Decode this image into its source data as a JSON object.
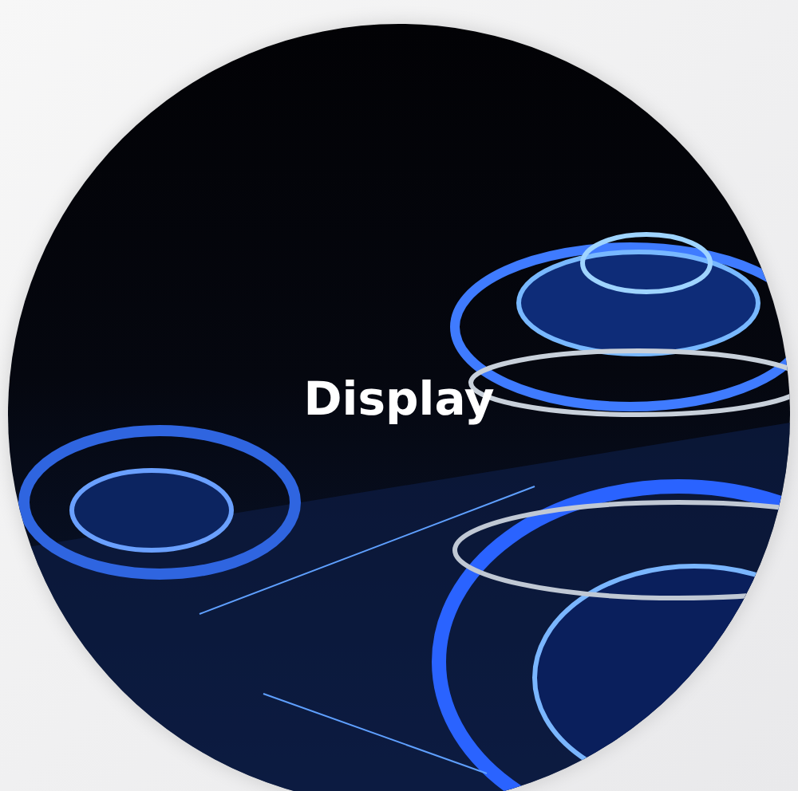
{
  "label": "Display"
}
